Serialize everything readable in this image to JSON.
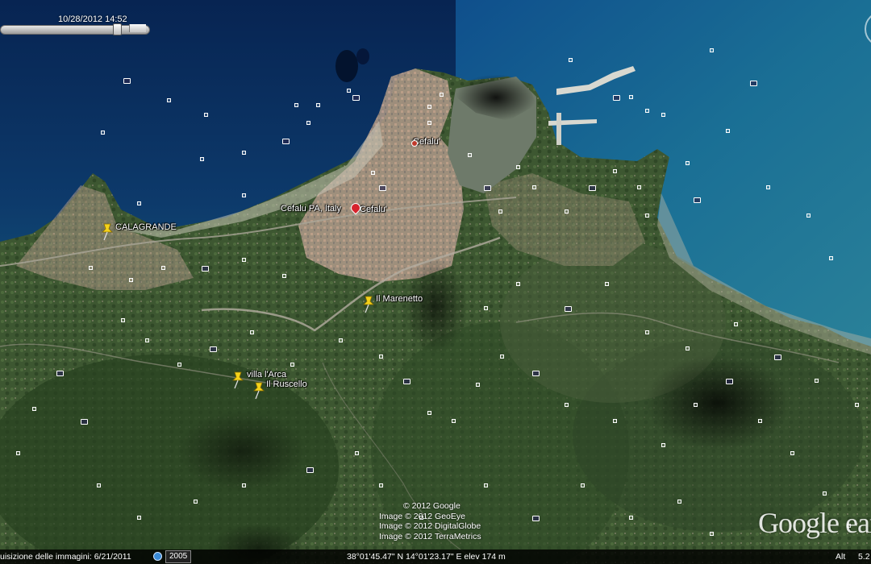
{
  "timestamp": "10/28/2012  14:52",
  "time_slider": {
    "position": 0.8
  },
  "pins": [
    {
      "label": "CALAGRANDE",
      "color": "#f4d21a"
    },
    {
      "label": "Il Marenetto",
      "color": "#f4d21a"
    },
    {
      "label": "villa l'Arca",
      "color": "#f4d21a"
    },
    {
      "label": "Il Ruscello",
      "color": "#f4d21a"
    }
  ],
  "places": [
    {
      "label": "Cefalu'"
    },
    {
      "label": "Cefalu'"
    },
    {
      "label": "Cefalu PA, Italy"
    }
  ],
  "copyright": {
    "line1": "© 2012 Google",
    "line2": "Image © 2012 GeoEye",
    "line3": "Image © 2012 DigitalGlobe",
    "line4": "Image © 2012 TerraMetrics"
  },
  "logo": "Google earth",
  "status": {
    "imagery_date": "uisizione delle immagini: 6/21/2011",
    "year": "2005",
    "coords": "38°01'45.47\" N   14°01'23.17\" E  elev   174 m",
    "alt": "Alt",
    "alt_value": "5.2"
  },
  "colors": {
    "sea_deep": "#0a2a5a",
    "sea_shallow": "#1b6d8f",
    "land": "#3f5a33",
    "town": "#b99a86",
    "pin": "#f4d21a"
  }
}
